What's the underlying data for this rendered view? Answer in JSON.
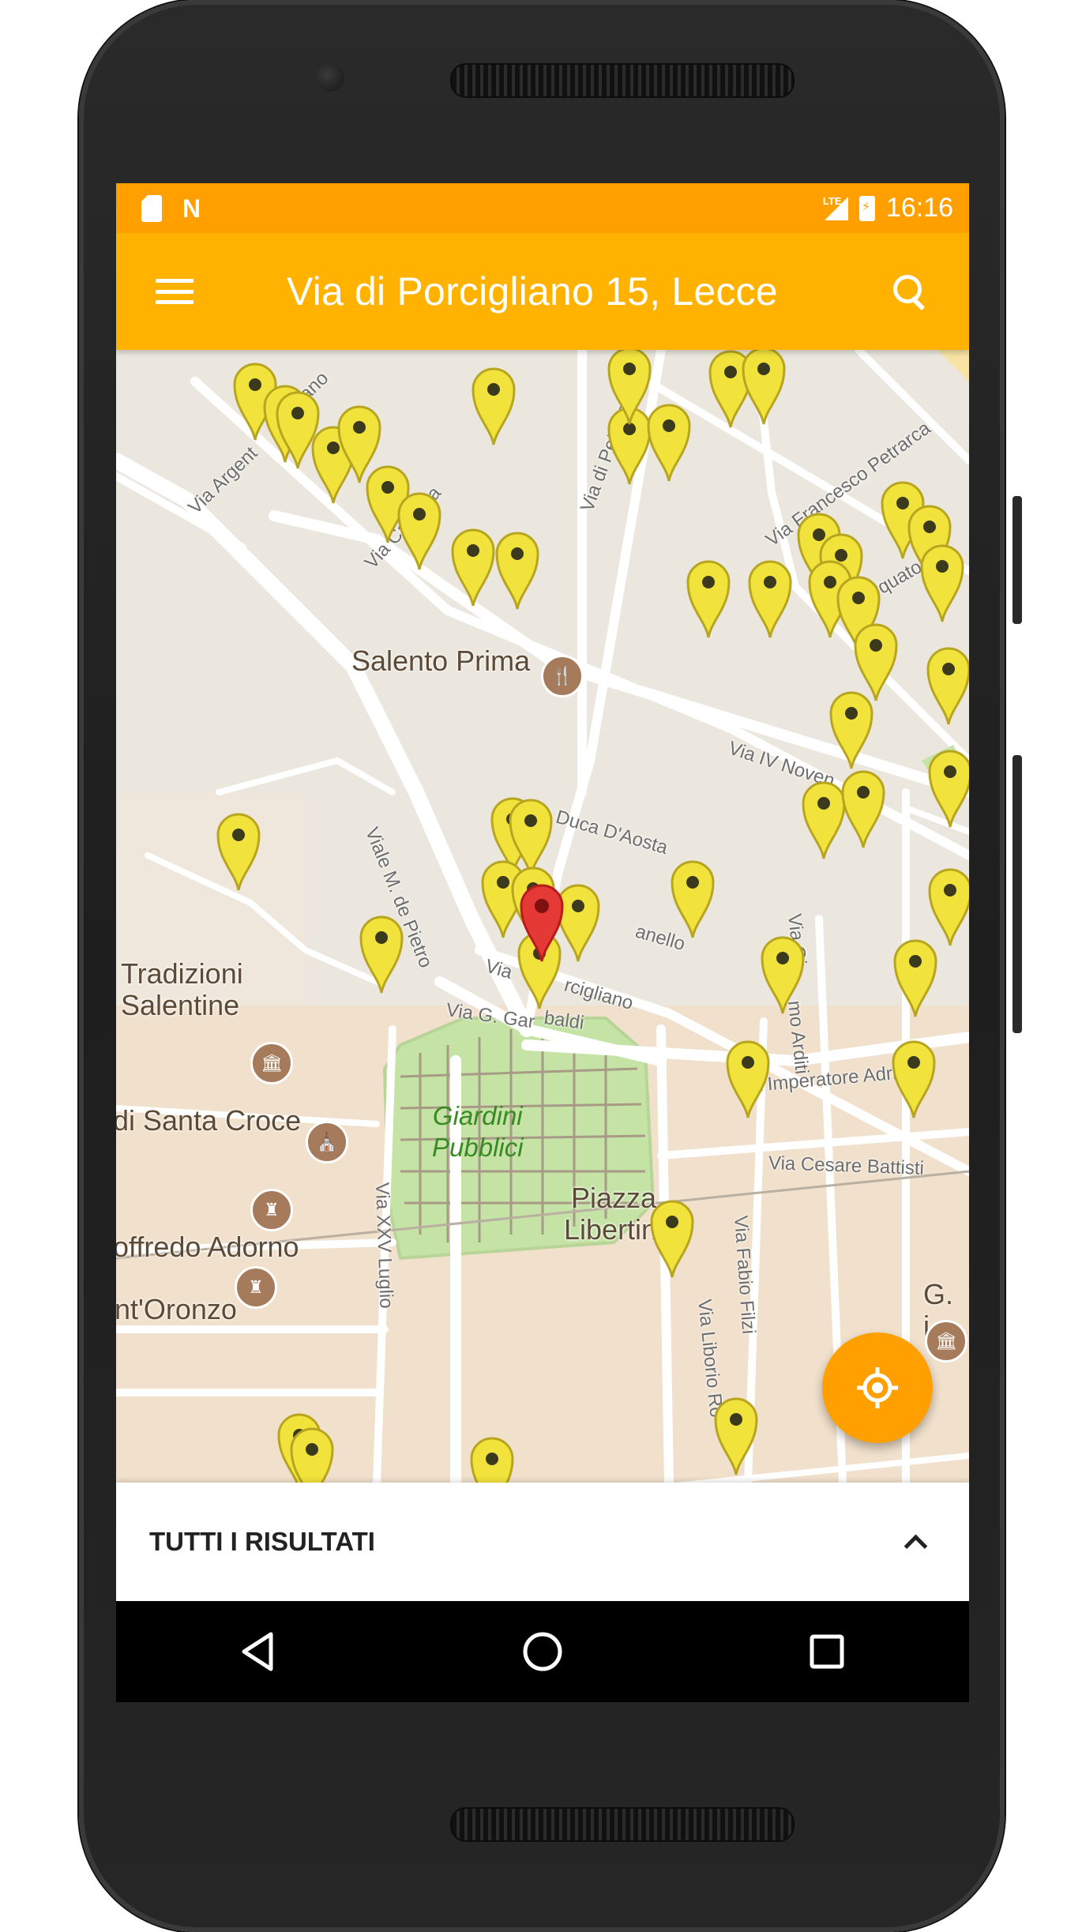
{
  "status_bar": {
    "network_label": "LTE",
    "time": "16:16"
  },
  "app_bar": {
    "title": "Via di Porcigliano 15, Lecce"
  },
  "map": {
    "place_labels": [
      {
        "text": "Salento Prima"
      },
      {
        "text": "Tradizioni\nSalentine"
      },
      {
        "text": "di Santa Croce"
      },
      {
        "text": "offredo Adorno"
      },
      {
        "text": "nt'Oronzo"
      },
      {
        "text": "Piazza\nLibertini"
      },
      {
        "text": "G.\ni"
      }
    ],
    "park_label": "Giardini\nPubblici",
    "street_labels": [
      {
        "text": "Via Argent"
      },
      {
        "text": "etano"
      },
      {
        "text": "Via Calabria"
      },
      {
        "text": "Via di Pettorano"
      },
      {
        "text": "Via Francesco Petrarca"
      },
      {
        "text": "orquato Tas"
      },
      {
        "text": "Via IV Noven"
      },
      {
        "text": "Via Duca D'Aosta"
      },
      {
        "text": "Viale M. de Pietro"
      },
      {
        "text": "anello"
      },
      {
        "text": "Via"
      },
      {
        "text": "rcigliano"
      },
      {
        "text": "Via G. Gar"
      },
      {
        "text": "baldi"
      },
      {
        "text": "Via Gi"
      },
      {
        "text": "mo Arditi"
      },
      {
        "text": "Via Imperatore Adrian"
      },
      {
        "text": "Via Cesare Battisti"
      },
      {
        "text": "Via XXV Luglio"
      },
      {
        "text": "Via Fabio Filzi"
      },
      {
        "text": "Via Liborio Ro"
      }
    ]
  },
  "bottom_sheet": {
    "title": "TUTTI I RISULTATI"
  },
  "colors": {
    "status_bar": "#ffa000",
    "app_bar": "#ffb300",
    "fab": "#ffa000",
    "pin_yellow": "#f2e33c",
    "pin_red": "#e53935",
    "park": "#c5e3a5"
  },
  "icons": {
    "menu": "menu-icon",
    "search": "search-icon",
    "location": "my-location-icon",
    "expand": "chevron-up-icon",
    "back": "back-triangle-icon",
    "home": "home-circle-icon",
    "recents": "recents-square-icon"
  }
}
